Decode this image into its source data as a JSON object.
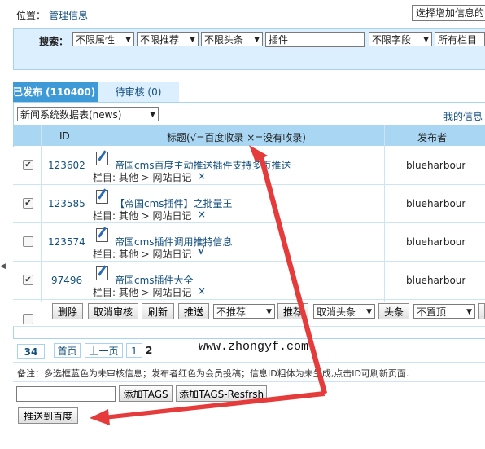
{
  "location": {
    "label": "位置：",
    "link": "管理信息"
  },
  "top_select": {
    "value": "选择增加信息的"
  },
  "search": {
    "label": "搜索：",
    "filter_attr": "不限属性",
    "filter_recommend": "不限推荐",
    "filter_headline": "不限头条",
    "keyword": "插件",
    "filter_field": "不限字段",
    "filter_column": "所有栏目"
  },
  "tabs": [
    {
      "label": "已发布 (110400)"
    },
    {
      "label": "待审核 (0)"
    }
  ],
  "table_select": {
    "value": "新闻系统数据表(news)"
  },
  "my_info": "我的信息",
  "headers": {
    "id": "ID",
    "title": "标题(√=百度收录 ×=没有收录)",
    "author": "发布者"
  },
  "rows": [
    {
      "checked": "✔",
      "id": "123602",
      "title": "帝国cms百度主动推送插件支持多页推送",
      "meta": "栏目: 其他 > 网站日记",
      "mark": "×",
      "author": "blueharbour"
    },
    {
      "checked": "✔",
      "id": "123585",
      "title": "【帝国cms插件】之批量王",
      "meta": "栏目: 其他 > 网站日记",
      "mark": "×",
      "author": "blueharbour"
    },
    {
      "checked": "",
      "id": "123574",
      "title": "帝国cms插件调用推特信息",
      "meta": "栏目: 其他 > 网站日记",
      "mark": "√",
      "author": "blueharbour"
    },
    {
      "checked": "✔",
      "id": "97496",
      "title": "帝国cms插件大全",
      "meta": "栏目: 其他 > 网站日记",
      "mark": "×",
      "author": "blueharbour"
    }
  ],
  "actions": {
    "delete": "删除",
    "cancel_review": "取消审核",
    "refresh": "刷新",
    "push": "推送",
    "not_recommend": "不推荐",
    "recommend": "推荐",
    "cancel_headline": "取消头条",
    "headline": "头条",
    "not_top": "不置顶"
  },
  "pager": {
    "total": "34",
    "first": "首页",
    "prev": "上一页",
    "page1": "1",
    "page2": "2"
  },
  "watermark": "www.zhongyf.com",
  "note": "备注：多选框蓝色为未审核信息；发布者红色为会员投稿；信息ID粗体为未生成,点击ID可刷新页面.",
  "tags": {
    "add": "添加TAGS",
    "add_refresh": "添加TAGS-Resfrsh"
  },
  "push_baidu": "推送到百度",
  "colors": {
    "accent": "#3e9ad7",
    "light": "#dcefff",
    "header": "#a8d6f3",
    "arrow": "#e53b3b"
  }
}
